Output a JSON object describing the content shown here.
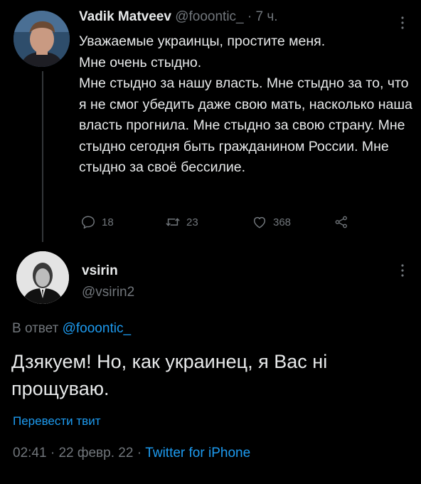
{
  "thread_tweet": {
    "author_name": "Vadik Matveev",
    "author_handle": "@fooontic_",
    "separator": "·",
    "time": "7 ч.",
    "lines": [
      "Уважаемые украинцы, простите меня.",
      "Мне очень стыдно.",
      "Мне стыдно за нашу власть. Мне стыдно за то, что я не смог убедить даже свою мать, насколько наша власть прогнила. Мне стыдно за свою страну. Мне стыдно сегодня быть гражданином России. Мне стыдно за своё бессилие."
    ],
    "actions": {
      "reply_count": "18",
      "retweet_count": "23",
      "like_count": "368"
    }
  },
  "main_tweet": {
    "author_name": "vsirin",
    "author_handle": "@vsirin2",
    "reply_to_prefix": "В ответ",
    "reply_to_handle": "@fooontic_",
    "text": "Дзякуем! Но, как украинец, я Вас ні прощуваю.",
    "translate_label": "Перевести твит",
    "time": "02:41",
    "separator": "·",
    "date": "22 февр. 22",
    "source": "Twitter for iPhone"
  },
  "colors": {
    "background": "#000000",
    "text": "#e7e9ea",
    "muted": "#71767b",
    "link": "#1d9bf0",
    "thread_line": "#333639"
  },
  "icons": {
    "more": "more-vertical-icon",
    "reply": "reply-icon",
    "retweet": "retweet-icon",
    "like": "heart-icon",
    "share": "share-icon"
  }
}
